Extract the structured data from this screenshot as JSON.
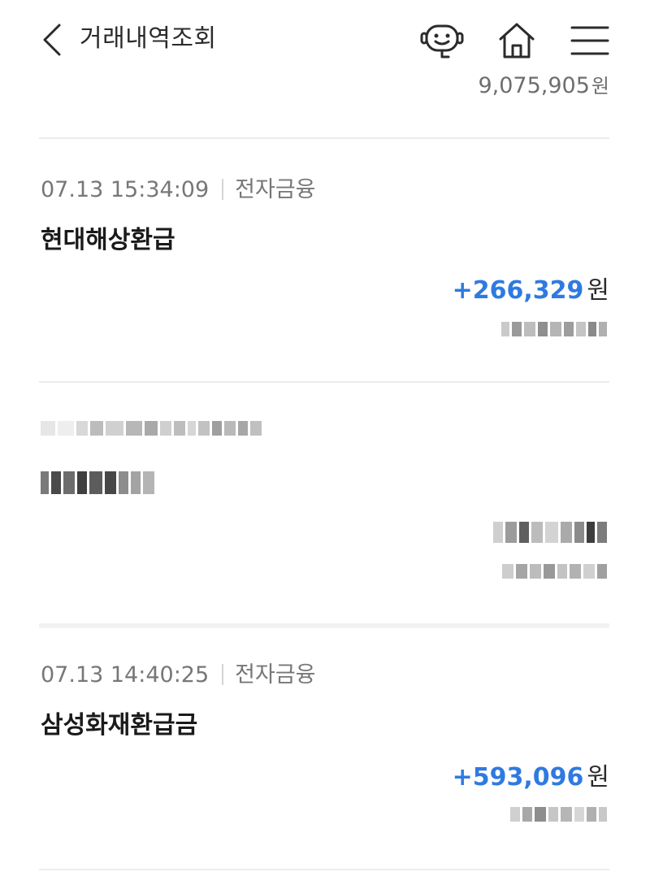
{
  "header": {
    "title": "거래내역조회",
    "back_icon": "chevron-left-icon",
    "icons": [
      "chatbot-icon",
      "home-icon",
      "menu-icon"
    ]
  },
  "previous_balance": {
    "value": "9,075,905",
    "unit": "원"
  },
  "transactions": [
    {
      "date": "07.13 15:34:09",
      "type": "전자금융",
      "name": "현대해상환급",
      "amount": "+266,329",
      "unit": "원"
    },
    {
      "date": "07.13 14:40:25",
      "type": "전자금융",
      "name": "삼성화재환급금",
      "amount": "+593,096",
      "unit": "원"
    }
  ],
  "colors": {
    "deposit": "#2f7ae0",
    "divider": "#ececec",
    "meta_text": "#777777"
  }
}
